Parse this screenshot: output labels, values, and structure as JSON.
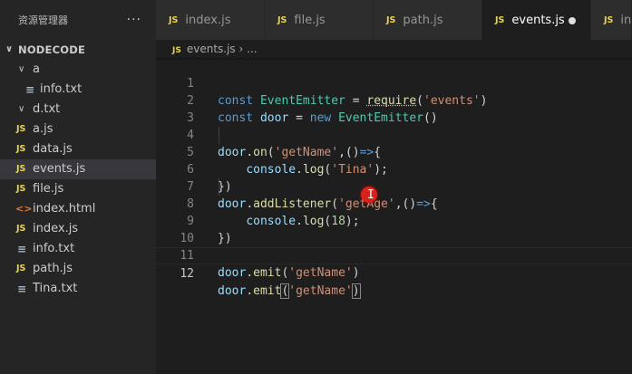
{
  "sidebar": {
    "title": "资源管理器",
    "more_icon": "···",
    "root": "NODECODE",
    "items": [
      {
        "label": "a",
        "kind": "folder",
        "level": 1,
        "icon": "chevron-down-icon"
      },
      {
        "label": "info.txt",
        "kind": "txt",
        "level": 2
      },
      {
        "label": "d.txt",
        "kind": "folder",
        "level": 1,
        "icon": "chevron-down-icon"
      },
      {
        "label": "a.js",
        "kind": "js",
        "level": 1
      },
      {
        "label": "data.js",
        "kind": "js",
        "level": 1
      },
      {
        "label": "events.js",
        "kind": "js",
        "level": 1,
        "selected": true
      },
      {
        "label": "file.js",
        "kind": "js",
        "level": 1
      },
      {
        "label": "index.html",
        "kind": "html",
        "level": 1
      },
      {
        "label": "index.js",
        "kind": "js",
        "level": 1
      },
      {
        "label": "info.txt",
        "kind": "txt",
        "level": 1
      },
      {
        "label": "path.js",
        "kind": "js",
        "level": 1
      },
      {
        "label": "Tina.txt",
        "kind": "txt",
        "level": 1
      }
    ]
  },
  "icons": {
    "js": "JS",
    "txt": "≡",
    "html": "<>",
    "chevron_down": "∨"
  },
  "tabs": [
    {
      "label": "index.js",
      "active": false
    },
    {
      "label": "file.js",
      "active": false
    },
    {
      "label": "path.js",
      "active": false
    },
    {
      "label": "events.js",
      "active": true,
      "modified": true
    },
    {
      "label": "in",
      "active": false
    }
  ],
  "breadcrumb": {
    "file": "events.js",
    "sep": "›",
    "rest": "..."
  },
  "editor": {
    "current_line": 12,
    "line_numbers": [
      "1",
      "2",
      "3",
      "4",
      "5",
      "6",
      "7",
      "8",
      "9",
      "10",
      "11",
      "12"
    ]
  },
  "colors": {
    "keyword": "#569cd6",
    "class": "#4ec9b0",
    "variable": "#9cdcfe",
    "function": "#dcdcaa",
    "string": "#ce9178",
    "number": "#b5cea8",
    "js_icon": "#e8d44d"
  }
}
